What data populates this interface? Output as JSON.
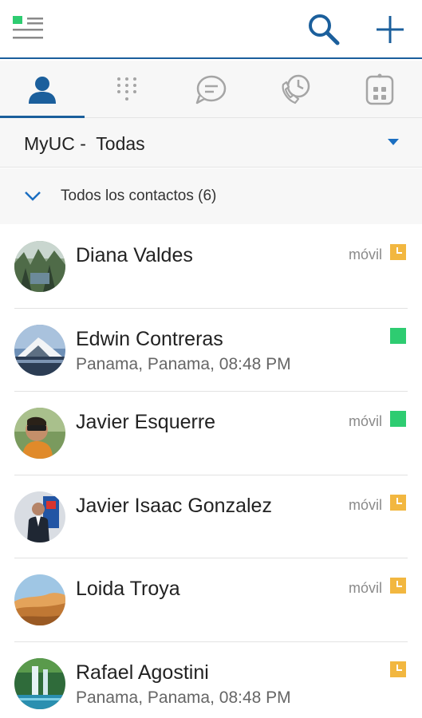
{
  "header": {
    "menu_icon": "menu-presence-icon",
    "search_icon": "search-icon",
    "add_icon": "plus-icon",
    "accent": "#1b5f9c"
  },
  "tabs": [
    {
      "icon": "person-icon",
      "active": true
    },
    {
      "icon": "dialpad-icon",
      "active": false
    },
    {
      "icon": "chat-icon",
      "active": false
    },
    {
      "icon": "call-history-icon",
      "active": false
    },
    {
      "icon": "apps-icon",
      "active": false
    }
  ],
  "directory": {
    "label": "MyUC -  Todas"
  },
  "group": {
    "label": "Todos los contactos (6)"
  },
  "contacts": [
    {
      "name": "Diana Valdes",
      "subtitle": "",
      "device": "móvil",
      "presence": "away",
      "presence_color": "#f2b740"
    },
    {
      "name": "Edwin Contreras",
      "subtitle": "Panama, Panama, 08:48 PM",
      "device": "",
      "presence": "available",
      "presence_color": "#2ecc71"
    },
    {
      "name": "Javier Esquerre",
      "subtitle": "",
      "device": "móvil",
      "presence": "available",
      "presence_color": "#2ecc71"
    },
    {
      "name": "Javier Isaac Gonzalez",
      "subtitle": "",
      "device": "móvil",
      "presence": "away",
      "presence_color": "#f2b740"
    },
    {
      "name": "Loida Troya",
      "subtitle": "",
      "device": "móvil",
      "presence": "away",
      "presence_color": "#f2b740"
    },
    {
      "name": "Rafael Agostini",
      "subtitle": "Panama, Panama, 08:48 PM",
      "device": "",
      "presence": "away",
      "presence_color": "#f2b740"
    }
  ]
}
